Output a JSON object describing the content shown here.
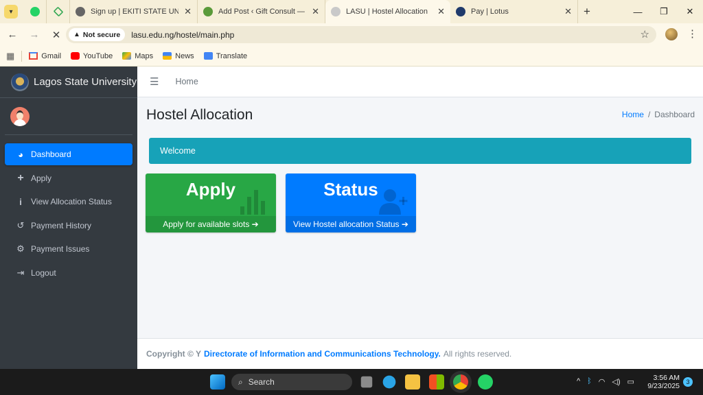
{
  "browser": {
    "tabs": [
      {
        "title": "Sign up | EKITI STATE UNIVERS"
      },
      {
        "title": "Add Post ‹ Gift Consult — Wor"
      },
      {
        "title": "LASU | Hostel Allocation"
      },
      {
        "title": "Pay | Lotus"
      }
    ],
    "security_label": "Not secure",
    "url": "lasu.edu.ng/hostel/main.php",
    "bookmarks": [
      "Gmail",
      "YouTube",
      "Maps",
      "News",
      "Translate"
    ]
  },
  "app": {
    "brand": "Lagos State University",
    "nav": [
      {
        "label": "Dashboard",
        "icon": "dashboard-icon",
        "active": true
      },
      {
        "label": "Apply",
        "icon": "plus-icon"
      },
      {
        "label": "View Allocation Status",
        "icon": "info-icon"
      },
      {
        "label": "Payment History",
        "icon": "history-icon"
      },
      {
        "label": "Payment Issues",
        "icon": "cogs-icon"
      },
      {
        "label": "Logout",
        "icon": "sign-out-icon"
      }
    ],
    "topnav": {
      "home": "Home"
    },
    "page_title": "Hostel Allocation",
    "breadcrumb": {
      "home": "Home",
      "current": "Dashboard"
    },
    "welcome": "Welcome",
    "cards": {
      "apply": {
        "title": "Apply",
        "footer": "Apply for available slots",
        "color": "#28a745"
      },
      "status": {
        "title": "Status",
        "footer": "View Hostel allocation Status",
        "color": "#007bff"
      }
    },
    "footer": {
      "copyright": "Copyright © Y",
      "org": "Directorate of Information and Communications Technology.",
      "rights": "All rights reserved."
    }
  },
  "taskbar": {
    "search": "Search",
    "time": "3:56 AM",
    "date": "9/23/2025",
    "notifications": "3"
  }
}
